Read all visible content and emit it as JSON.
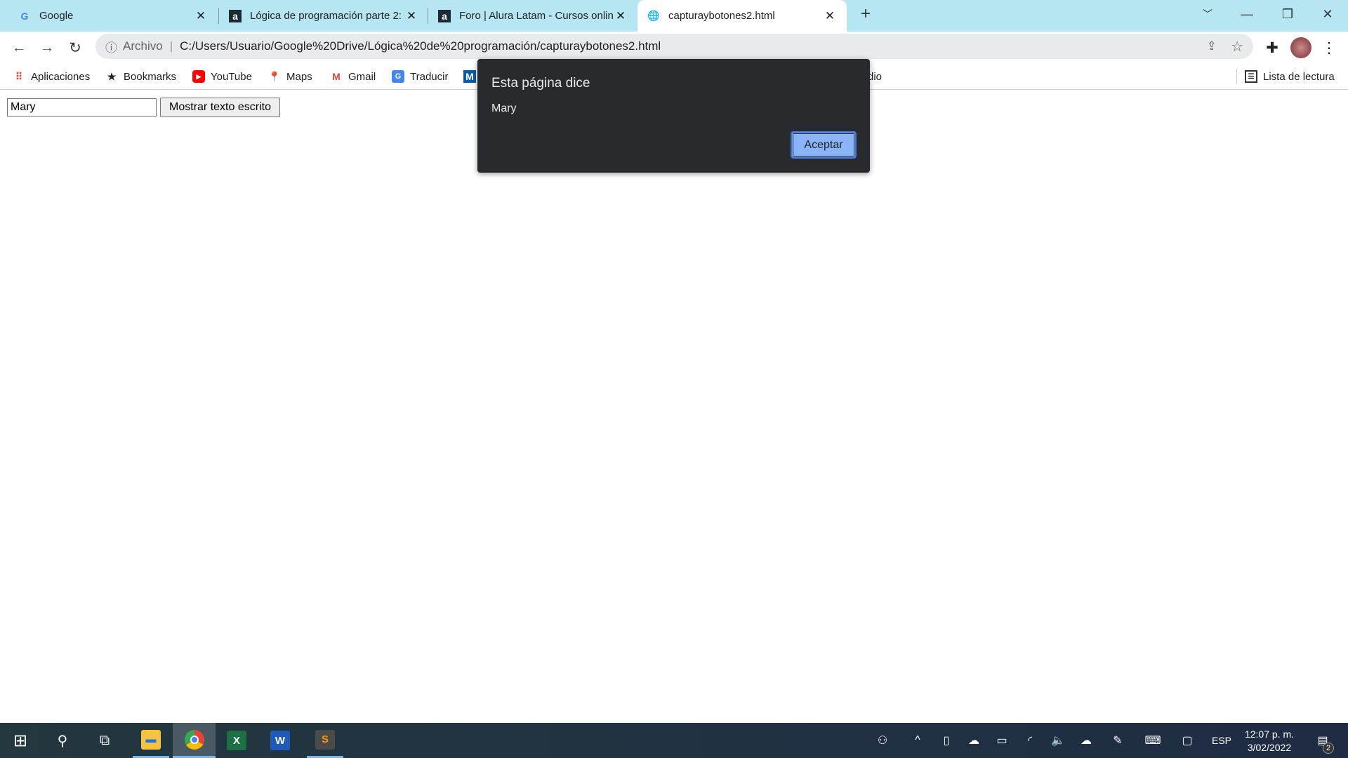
{
  "browser": {
    "tabs": [
      {
        "title": "Google",
        "icon": "google-icon",
        "active": false
      },
      {
        "title": "Lógica de programación parte 2: ",
        "icon": "alura-icon",
        "active": false
      },
      {
        "title": "Foro | Alura Latam - Cursos online",
        "icon": "alura-icon",
        "active": false
      },
      {
        "title": "capturaybotones2.html",
        "icon": "globe-icon",
        "active": true
      }
    ],
    "new_tab": "+",
    "address": {
      "scheme_label": "Archivo",
      "url": "C:/Users/Usuario/Google%20Drive/Lógica%20de%20programación/capturaybotones2.html"
    },
    "bookmarks": [
      {
        "label": "Aplicaciones",
        "icon": "apps-grid-icon"
      },
      {
        "label": "Bookmarks",
        "icon": "star-icon"
      },
      {
        "label": "YouTube",
        "icon": "youtube-icon"
      },
      {
        "label": "Maps",
        "icon": "maps-icon"
      },
      {
        "label": "Gmail",
        "icon": "gmail-icon"
      },
      {
        "label": "Traducir",
        "icon": "translate-icon"
      }
    ],
    "partial_bookmark": "dio",
    "reading_list": "Lista de lectura"
  },
  "page": {
    "input_value": "Mary",
    "button_label": "Mostrar texto escrito"
  },
  "dialog": {
    "title": "Esta página dice",
    "message": "Mary",
    "ok_label": "Aceptar"
  },
  "taskbar": {
    "language": "ESP",
    "time": "12:07 p. m.",
    "date": "3/02/2022",
    "notification_count": "2"
  },
  "colors": {
    "tabbar": "#b6e6f2",
    "dialog_bg": "#292a2d",
    "dialog_button": "#8ab4f8",
    "taskbar": "#23373f"
  }
}
